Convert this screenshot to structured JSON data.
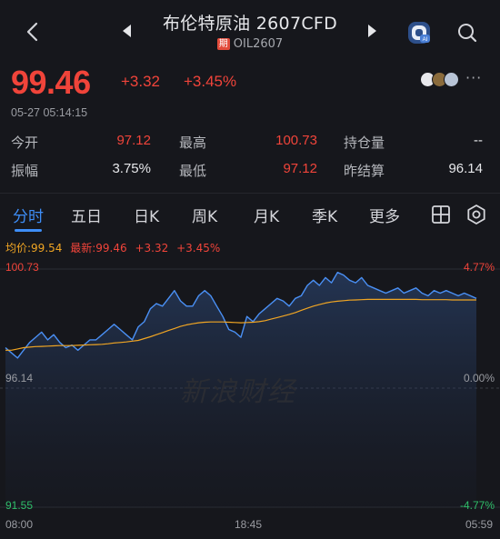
{
  "header": {
    "title": "布伦特原油 2607CFD",
    "tag": "期",
    "code": "OIL2607"
  },
  "quote": {
    "price": "99.46",
    "change_abs": "+3.32",
    "change_pct": "+3.45%",
    "timestamp": "05-27 05:14:15"
  },
  "stats": {
    "open_label": "今开",
    "open_value": "97.12",
    "high_label": "最高",
    "high_value": "100.73",
    "oi_label": "持仓量",
    "oi_value": "--",
    "amp_label": "振幅",
    "amp_value": "3.75%",
    "low_label": "最低",
    "low_value": "97.12",
    "prev_label": "昨结算",
    "prev_value": "96.14"
  },
  "tabs": [
    "分时",
    "五日",
    "日K",
    "周K",
    "月K",
    "季K",
    "更多"
  ],
  "active_tab": "分时",
  "legend": {
    "avg": "均价:99.54",
    "latest": "最新:99.46",
    "change_abs": "+3.32",
    "change_pct": "+3.45%"
  },
  "colors": {
    "up": "#f0443a",
    "down": "#2fbf6a",
    "accent": "#3e8ef7",
    "price_line": "#4a90f5",
    "avg_line": "#f0a523",
    "background": "#16171c"
  },
  "icons": {
    "back": "chevron-left-icon",
    "prev": "triangle-left-icon",
    "next": "triangle-right-icon",
    "ai": "ai-assistant-icon",
    "search": "search-icon",
    "more": "more-dots-icon",
    "grid": "grid-icon",
    "settings": "settings-icon"
  },
  "watermark": "新浪财经",
  "more_dots": "···",
  "chart_data": {
    "type": "line",
    "y_left_ticks": [
      "100.73",
      "96.14",
      "91.55"
    ],
    "y_right_ticks": [
      "4.77%",
      "0.00%",
      "-4.77%"
    ],
    "x_ticks": [
      "08:00",
      "18:45",
      "05:59"
    ],
    "ylim": [
      91.55,
      100.73
    ],
    "reference": 96.14,
    "series": [
      {
        "name": "最新",
        "values": [
          97.7,
          97.5,
          97.3,
          97.6,
          97.9,
          98.1,
          98.3,
          98.0,
          98.2,
          97.9,
          97.7,
          97.8,
          97.6,
          97.8,
          98.0,
          98.0,
          98.2,
          98.4,
          98.6,
          98.4,
          98.2,
          98.0,
          98.5,
          98.7,
          99.2,
          99.4,
          99.3,
          99.6,
          99.9,
          99.5,
          99.3,
          99.3,
          99.7,
          99.9,
          99.7,
          99.3,
          98.9,
          98.4,
          98.3,
          98.1,
          98.9,
          98.7,
          99.0,
          99.2,
          99.4,
          99.6,
          99.5,
          99.3,
          99.6,
          99.7,
          100.1,
          100.3,
          100.1,
          100.4,
          100.2,
          100.6,
          100.5,
          100.3,
          100.2,
          100.4,
          100.1,
          100.0,
          99.9,
          99.8,
          99.9,
          100.0,
          99.8,
          99.9,
          100.0,
          99.8,
          99.7,
          99.9,
          99.8,
          99.9,
          99.8,
          99.7,
          99.8,
          99.7,
          99.6
        ]
      },
      {
        "name": "均价",
        "values": [
          97.6,
          97.6,
          97.65,
          97.7,
          97.72,
          97.74,
          97.75,
          97.76,
          97.77,
          97.78,
          97.78,
          97.78,
          97.79,
          97.8,
          97.81,
          97.82,
          97.83,
          97.85,
          97.88,
          97.9,
          97.92,
          97.95,
          97.98,
          98.05,
          98.12,
          98.2,
          98.28,
          98.36,
          98.44,
          98.52,
          98.58,
          98.62,
          98.66,
          98.68,
          98.69,
          98.69,
          98.69,
          98.68,
          98.67,
          98.66,
          98.67,
          98.68,
          98.7,
          98.74,
          98.8,
          98.86,
          98.92,
          98.98,
          99.05,
          99.14,
          99.22,
          99.3,
          99.36,
          99.42,
          99.46,
          99.49,
          99.51,
          99.53,
          99.54,
          99.55,
          99.56,
          99.56,
          99.56,
          99.56,
          99.56,
          99.56,
          99.56,
          99.56,
          99.56,
          99.55,
          99.55,
          99.55,
          99.55,
          99.55,
          99.54,
          99.54,
          99.54,
          99.54,
          99.54
        ]
      }
    ]
  }
}
